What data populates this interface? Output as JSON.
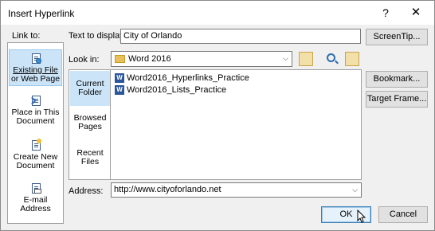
{
  "window": {
    "title": "Insert Hyperlink",
    "help_glyph": "?",
    "close_glyph": "✕"
  },
  "link_to": {
    "label": "Link to:",
    "items": [
      {
        "label_l1": "Existing File",
        "label_l2": "or Web Page",
        "icon": "existing-file-icon",
        "selected": true
      },
      {
        "label_l1": "Place in This",
        "label_l2": "Document",
        "icon": "place-in-document-icon",
        "selected": false
      },
      {
        "label_l1": "Create New",
        "label_l2": "Document",
        "icon": "create-new-document-icon",
        "selected": false
      },
      {
        "label_l1": "E-mail",
        "label_l2": "Address",
        "icon": "email-address-icon",
        "selected": false
      }
    ]
  },
  "text_to_display": {
    "label": "Text to display:",
    "value": "City of Orlando"
  },
  "screentip_label": "ScreenTip...",
  "look_in": {
    "label": "Look in:",
    "value": "Word 2016"
  },
  "nav": [
    {
      "l1": "Current",
      "l2": "Folder",
      "selected": true
    },
    {
      "l1": "Browsed",
      "l2": "Pages",
      "selected": false
    },
    {
      "l1": "Recent",
      "l2": "Files",
      "selected": false
    }
  ],
  "files": [
    {
      "name": "Word2016_Hyperlinks_Practice"
    },
    {
      "name": "Word2016_Lists_Practice"
    }
  ],
  "right_buttons": {
    "bookmark": "Bookmark...",
    "target_frame": "Target Frame..."
  },
  "address": {
    "label": "Address:",
    "value": "http://www.cityoforlando.net"
  },
  "ok_label": "OK",
  "cancel_label": "Cancel"
}
